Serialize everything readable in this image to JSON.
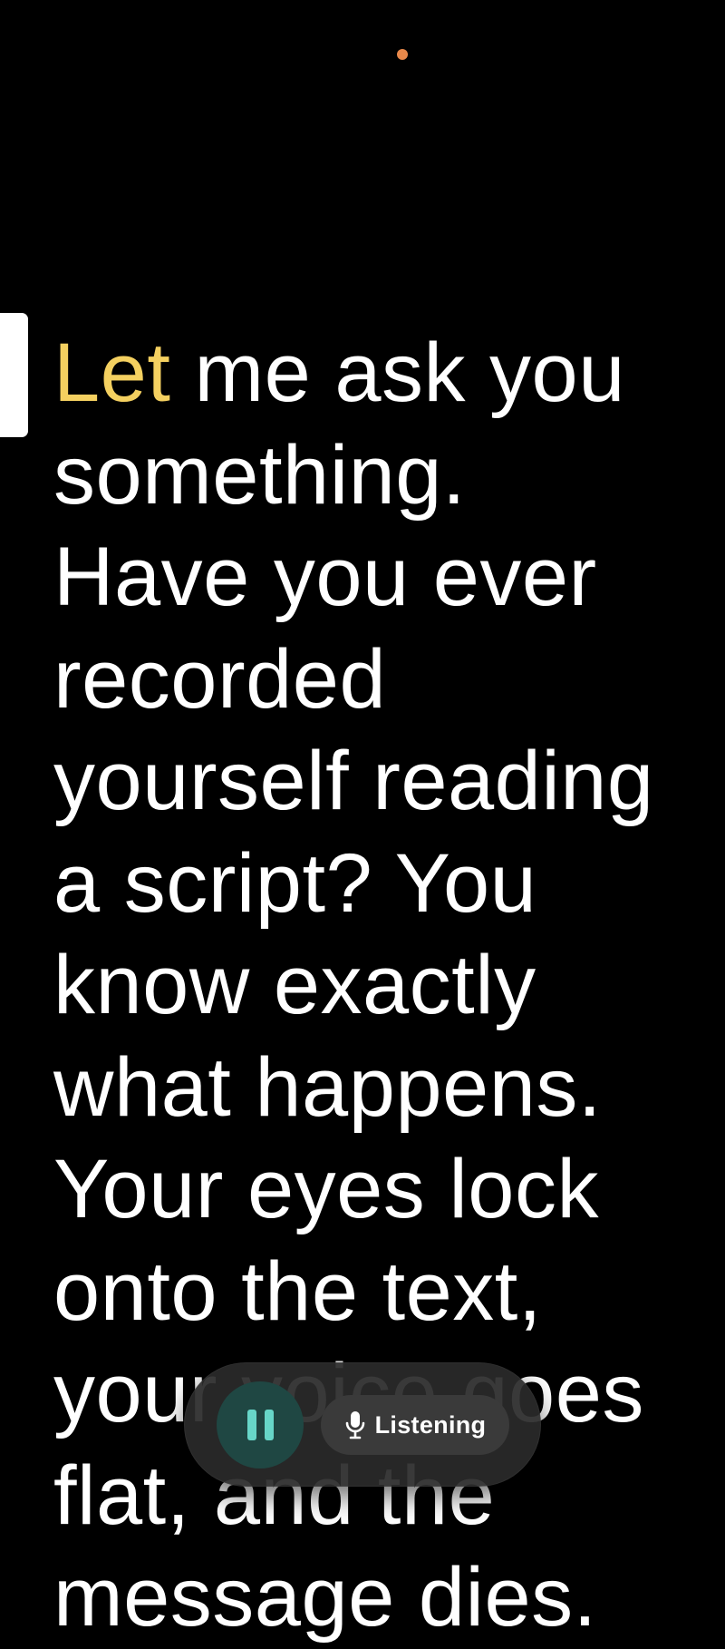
{
  "script": {
    "highlighted_word": "Let",
    "remaining_text": " me ask you\nsomething.\nHave you ever\nrecorded\nyourself reading\na script? You\nknow exactly\nwhat happens.\nYour eyes lock\nonto the text,\nyour voice goes\nflat, and the\nmessage dies."
  },
  "controls": {
    "pause_icon": "pause-icon",
    "mic_icon": "microphone-icon",
    "listening_label": "Listening"
  },
  "colors": {
    "background": "#000000",
    "text": "#ffffff",
    "highlight": "#f4d060",
    "pause_accent": "#67d6c8",
    "camera_dot": "#e8884a"
  }
}
